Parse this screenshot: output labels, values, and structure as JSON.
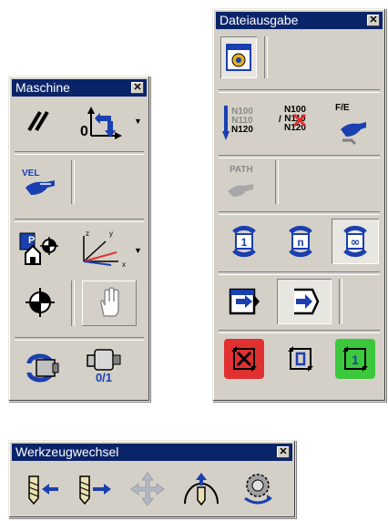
{
  "maschine": {
    "title": "Maschine",
    "close": "✕",
    "axis_zero": "0"
  },
  "dateiausgabe": {
    "title": "Dateiausgabe",
    "close": "✕",
    "nc_lines_a": [
      "N100",
      "N110",
      "N120"
    ],
    "nc_lines_b": [
      "N100",
      "N110",
      "N120"
    ],
    "fe_label": "F/E",
    "path_label": "PATH",
    "mode_single": "1",
    "mode_n": "n",
    "mode_infinite": "∞",
    "btn_single": "1"
  },
  "maschine_extra": {
    "vel_label": "VEL",
    "pin_label": "P",
    "zero_one_label": "0/1",
    "axis_x": "x",
    "axis_y": "y",
    "axis_z": "z"
  },
  "werkzeugwechsel": {
    "title": "Werkzeugwechsel",
    "close": "✕"
  },
  "colors": {
    "titlebar": "#0a246a",
    "face": "#d4d0c8",
    "red_button": "#e03030",
    "green_button": "#3cc83c",
    "blue_icon": "#1a3fb0"
  }
}
